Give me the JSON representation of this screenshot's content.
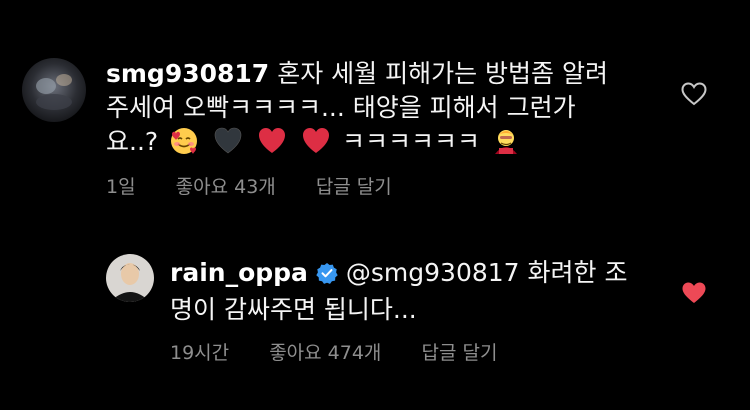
{
  "comments": [
    {
      "username": "smg930817",
      "lines": [
        "혼자 세월 피해가는 방법좀 알려",
        "주세여 오빡ㅋㅋㅋㅋ... 태양을 피해서 그런가",
        "요..?"
      ],
      "laugh_tail": "ㅋㅋㅋㅋㅋㅋ",
      "emojis": [
        "smiling-hearts-emoji",
        "black-heart-emoji",
        "red-heart-emoji",
        "red-heart-emoji",
        "superhero-emoji"
      ],
      "time": "1일",
      "likes": "좋아요 43개",
      "reply_label": "답글 달기",
      "liked": false
    },
    {
      "username": "rain_oppa",
      "verified": true,
      "lines": [
        "@smg930817 화려한 조",
        "명이 감싸주면 됩니다..."
      ],
      "time": "19시간",
      "likes": "좋아요 474개",
      "reply_label": "답글 달기",
      "liked": true
    }
  ],
  "colors": {
    "background": "#000000",
    "text": "#f5f5f5",
    "meta": "#8e8e8e",
    "heart_liked": "#ed4956",
    "heart_outline": "#c7c7c7",
    "verified": "#3897f0"
  }
}
